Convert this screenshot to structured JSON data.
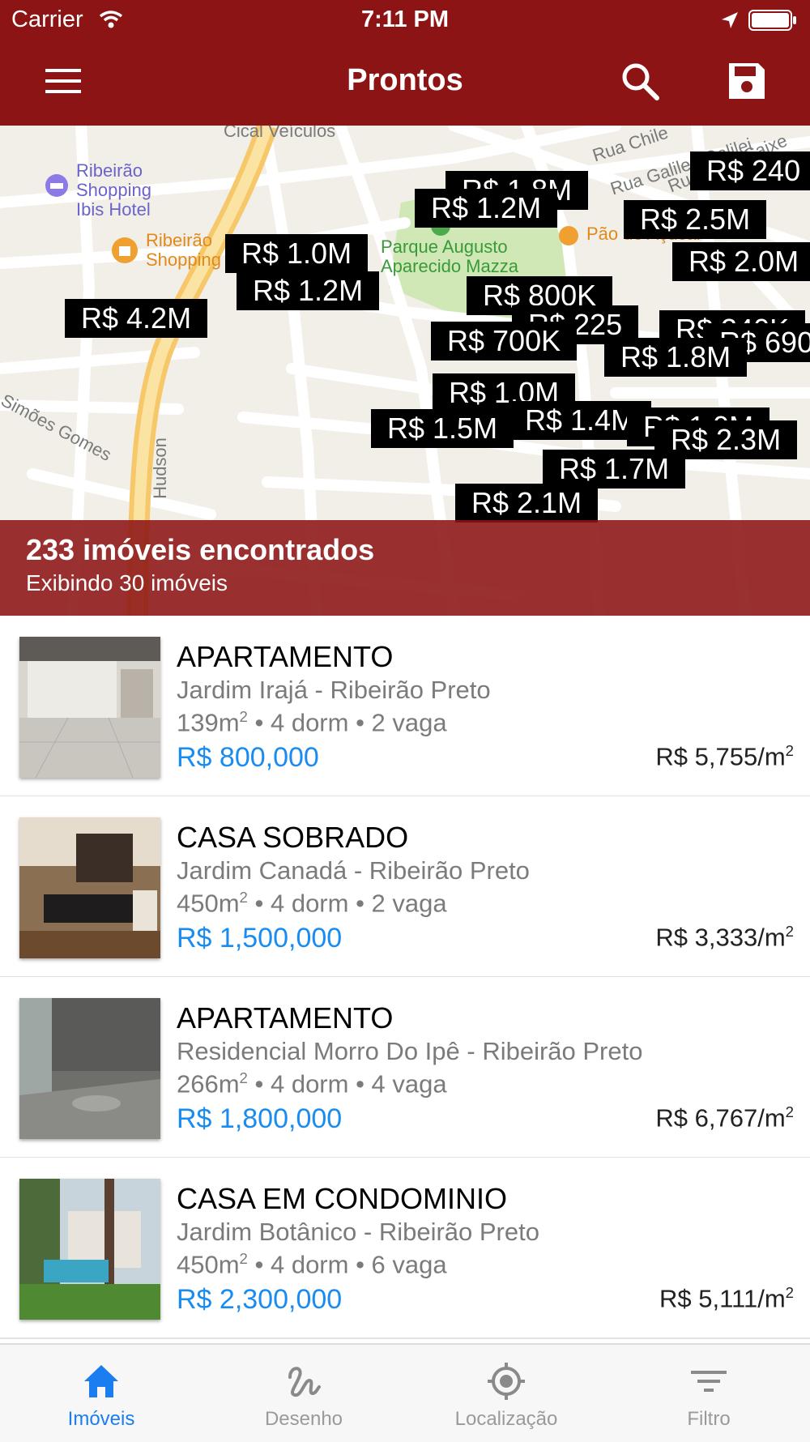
{
  "status_bar": {
    "carrier": "Carrier",
    "time": "7:11 PM"
  },
  "nav": {
    "title": "Prontos",
    "icons": [
      "menu-icon",
      "search-icon",
      "save-icon"
    ]
  },
  "map": {
    "street_labels": [
      "Cical Veículos",
      "Rua Chile",
      "Rua Galileu Galilei",
      "Rua João Caixe",
      "Simões Gomes",
      "Hudson"
    ],
    "poi_labels": {
      "hotel": "Ribeirão Shopping Ibis Hotel",
      "shopping": "Ribeirão Shopping",
      "park": "Parque Augusto Aparecido Mazza",
      "market": "Pão de Açúcar"
    },
    "price_markers": [
      "R$ 1.8M",
      "R$ 240",
      "R$ 1.2M",
      "R$ 2.5M",
      "R$ 2.0M",
      "R$ 1.0M",
      "R$ 1.2M",
      "R$ 800K",
      "R$ 4.2M",
      "R$ 225",
      "R$ 240K",
      "R$ 690",
      "R$ 700K",
      "R$ 1.8M",
      "R$ 1.0M",
      "R$ 1.4M",
      "R$ 1.5M",
      "R$ 1.0M",
      "R$ 2.3M",
      "R$ 1.7M",
      "R$ 2.1M"
    ],
    "results_count": "233 imóveis encontrados",
    "results_showing": "Exibindo 30 imóveis"
  },
  "listings": [
    {
      "type": "APARTAMENTO",
      "location": "Jardim Irajá - Ribeirão Preto",
      "area": "139m",
      "specs": " • 4 dorm • 2 vaga",
      "price": "R$ 800,000",
      "price_per_m": "R$ 5,755/m"
    },
    {
      "type": "CASA SOBRADO",
      "location": "Jardim Canadá - Ribeirão Preto",
      "area": "450m",
      "specs": " • 4 dorm • 2 vaga",
      "price": "R$ 1,500,000",
      "price_per_m": "R$ 3,333/m"
    },
    {
      "type": "APARTAMENTO",
      "location": "Residencial Morro Do Ipê - Ribeirão Preto",
      "area": "266m",
      "specs": " • 4 dorm • 4 vaga",
      "price": "R$ 1,800,000",
      "price_per_m": "R$ 6,767/m"
    },
    {
      "type": "CASA EM CONDOMINIO",
      "location": "Jardim Botânico - Ribeirão Preto",
      "area": "450m",
      "specs": " • 4 dorm • 6 vaga",
      "price": "R$ 2,300,000",
      "price_per_m": "R$ 5,111/m"
    }
  ],
  "squared": "2",
  "tabs": [
    {
      "label": "Imóveis",
      "icon": "home-icon",
      "active": true
    },
    {
      "label": "Desenho",
      "icon": "draw-icon",
      "active": false
    },
    {
      "label": "Localização",
      "icon": "crosshair-icon",
      "active": false
    },
    {
      "label": "Filtro",
      "icon": "filter-icon",
      "active": false
    }
  ],
  "colors": {
    "brand": "#8c1414",
    "price": "#1a8cf0",
    "tab_active": "#1a7ef0",
    "tab_inactive": "#9a9a9a",
    "park": "#cfe8b5"
  }
}
